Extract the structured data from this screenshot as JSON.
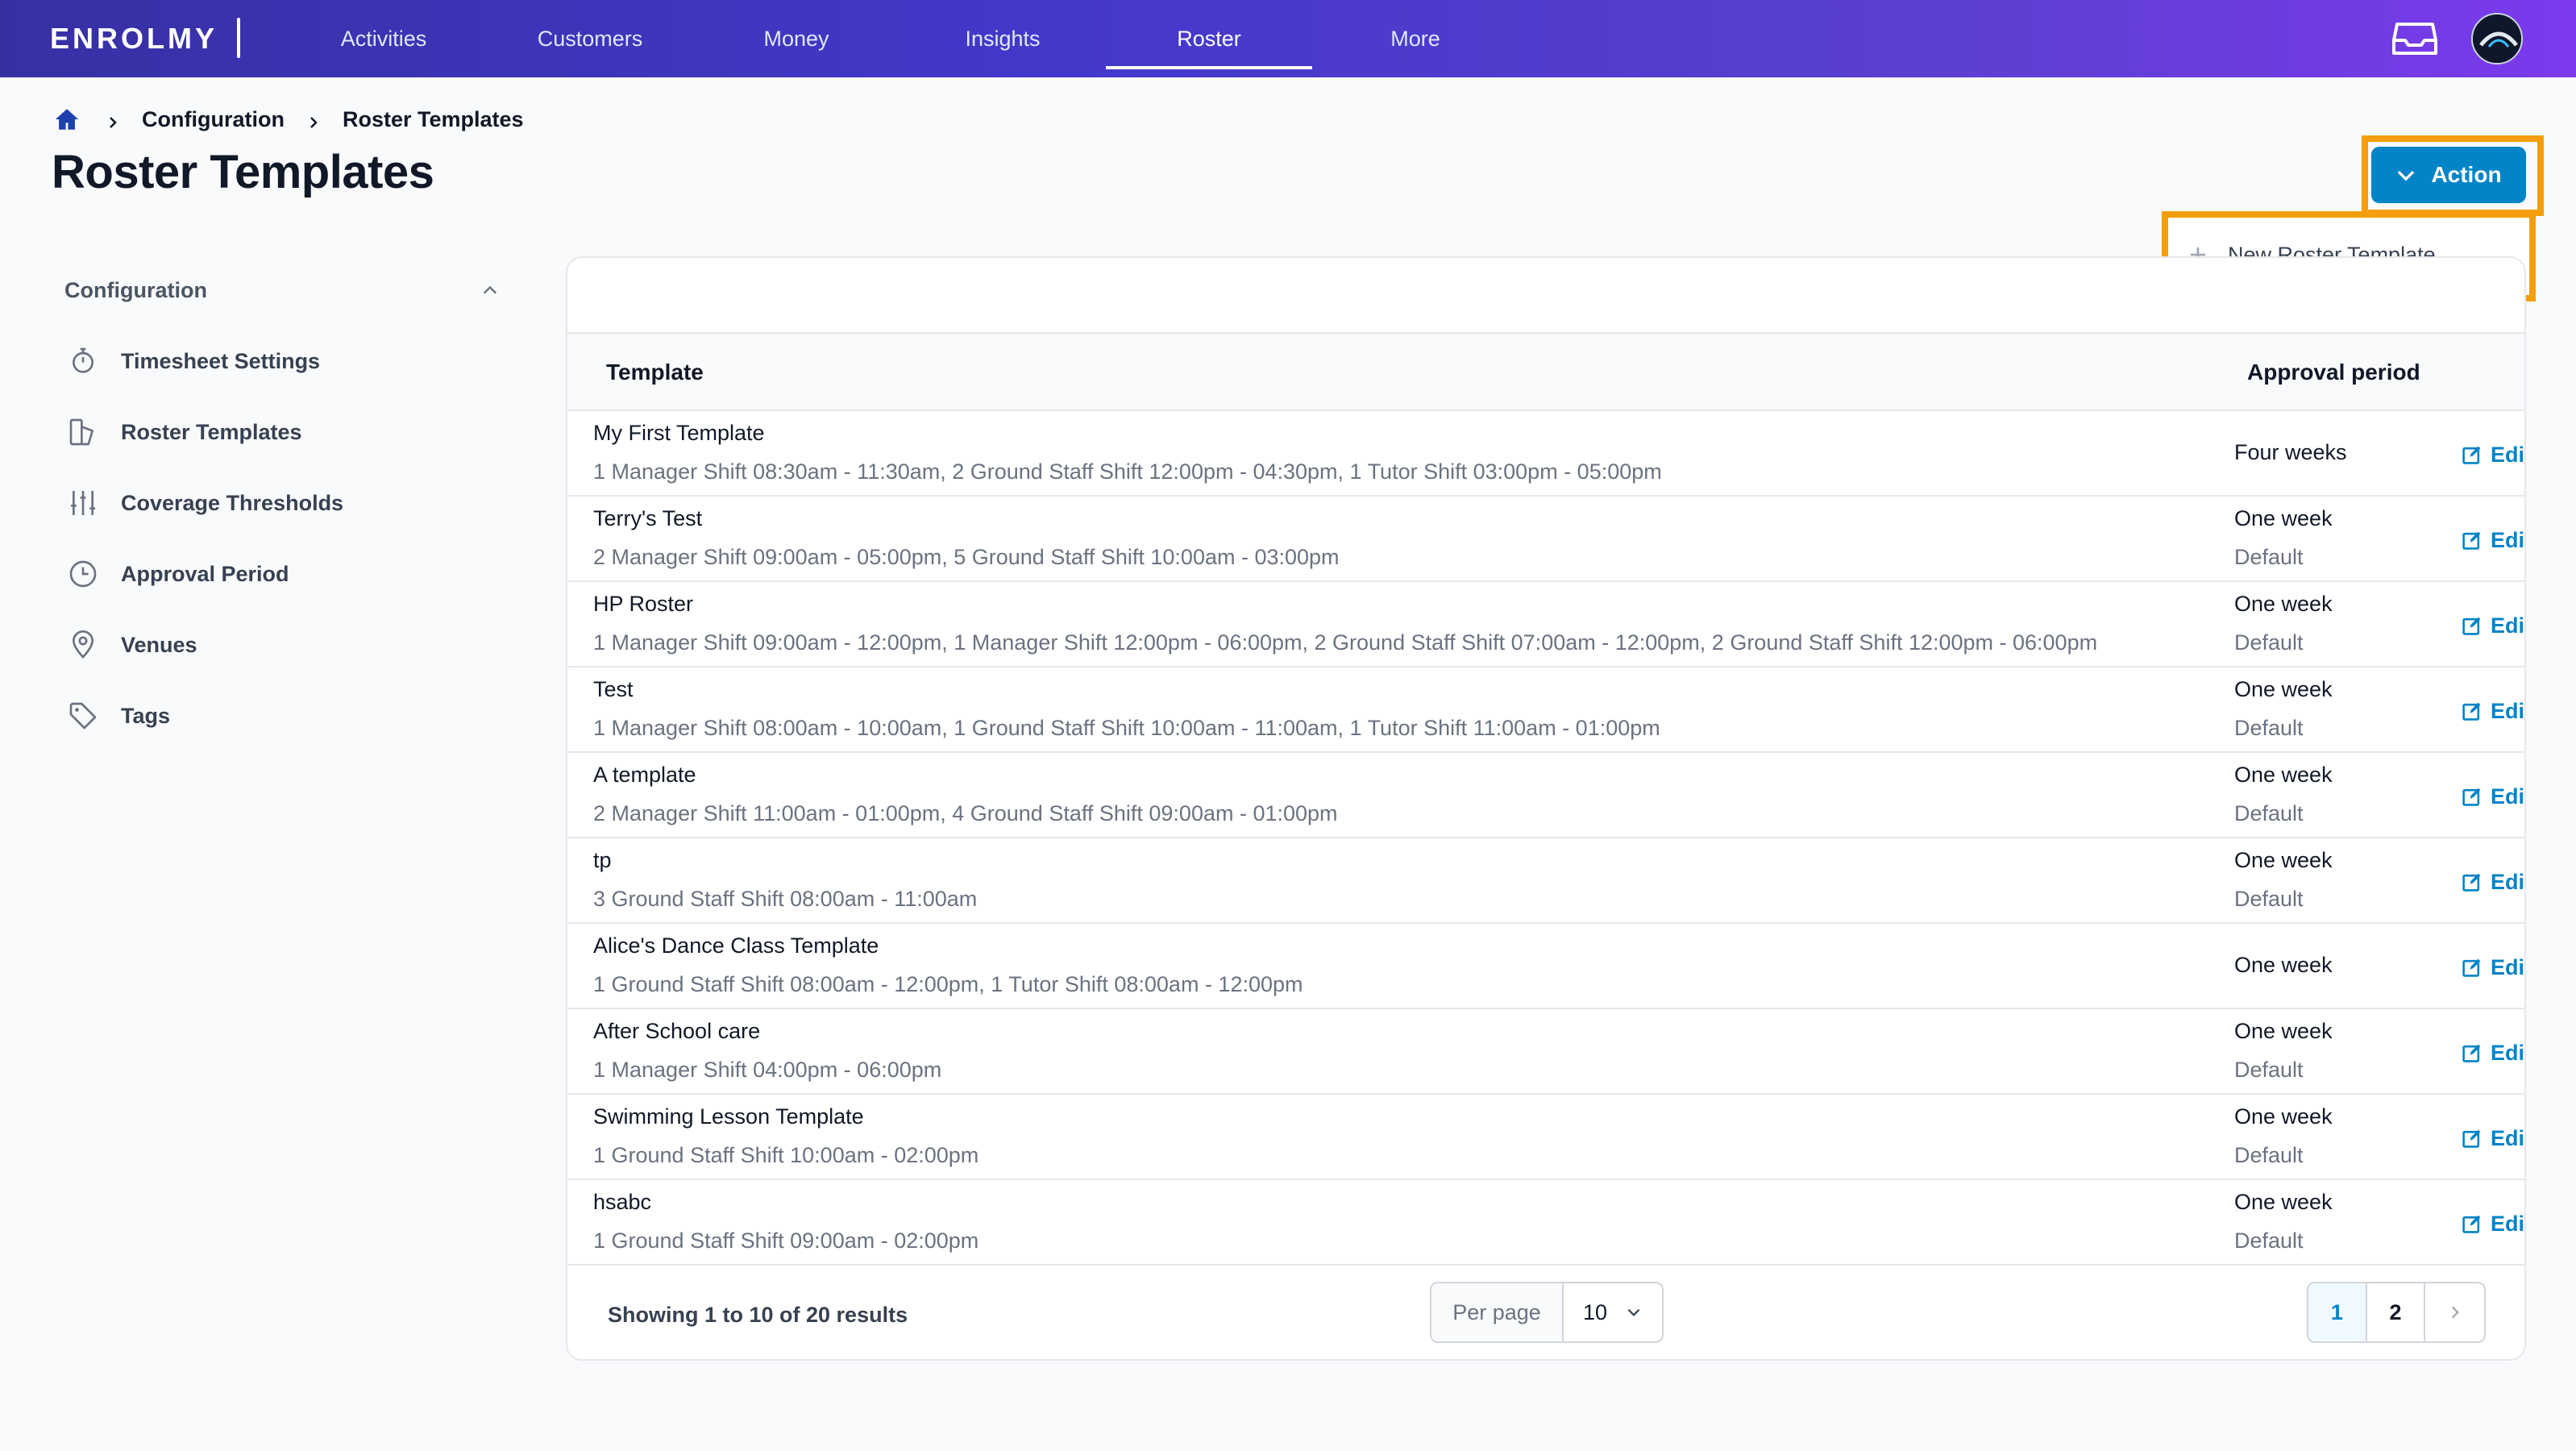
{
  "app": {
    "brand": "ENROLMY",
    "nav": [
      {
        "label": "Activities",
        "active": false
      },
      {
        "label": "Customers",
        "active": false
      },
      {
        "label": "Money",
        "active": false
      },
      {
        "label": "Insights",
        "active": false
      },
      {
        "label": "Roster",
        "active": true
      },
      {
        "label": "More",
        "active": false
      }
    ],
    "colors": {
      "nav_start": "#3730a3",
      "nav_end": "#7c3aed",
      "accent": "#0284c7",
      "highlight": "#f59e0b"
    }
  },
  "breadcrumb": {
    "items": [
      "Configuration",
      "Roster Templates"
    ]
  },
  "page": {
    "title": "Roster Templates"
  },
  "action": {
    "label": "Action",
    "menu": [
      {
        "label": "New Roster Template",
        "icon": "plus-icon"
      }
    ]
  },
  "sidebar": {
    "heading": "Configuration",
    "items": [
      {
        "label": "Timesheet Settings",
        "icon": "stopwatch-icon"
      },
      {
        "label": "Roster Templates",
        "icon": "template-icon"
      },
      {
        "label": "Coverage Thresholds",
        "icon": "sliders-icon"
      },
      {
        "label": "Approval Period",
        "icon": "clock-icon"
      },
      {
        "label": "Venues",
        "icon": "map-pin-icon"
      },
      {
        "label": "Tags",
        "icon": "tag-icon"
      }
    ]
  },
  "table": {
    "columns": [
      "Template",
      "Approval period"
    ],
    "edit_label": "Edi",
    "rows": [
      {
        "name": "My First Template",
        "shifts": "1 Manager Shift 08:30am - 11:30am, 2 Ground Staff Shift 12:00pm - 04:30pm, 1 Tutor Shift 03:00pm - 05:00pm",
        "approval": "Four weeks",
        "default": ""
      },
      {
        "name": "Terry's Test",
        "shifts": "2 Manager Shift 09:00am - 05:00pm, 5 Ground Staff Shift 10:00am - 03:00pm",
        "approval": "One week",
        "default": "Default"
      },
      {
        "name": "HP Roster",
        "shifts": "1 Manager Shift 09:00am - 12:00pm, 1 Manager Shift 12:00pm - 06:00pm, 2 Ground Staff Shift 07:00am - 12:00pm, 2 Ground Staff Shift 12:00pm - 06:00pm",
        "approval": "One week",
        "default": "Default"
      },
      {
        "name": "Test",
        "shifts": "1 Manager Shift 08:00am - 10:00am, 1 Ground Staff Shift 10:00am - 11:00am, 1 Tutor Shift 11:00am - 01:00pm",
        "approval": "One week",
        "default": "Default"
      },
      {
        "name": "A template",
        "shifts": "2 Manager Shift 11:00am - 01:00pm, 4 Ground Staff Shift 09:00am - 01:00pm",
        "approval": "One week",
        "default": "Default"
      },
      {
        "name": "tp",
        "shifts": "3 Ground Staff Shift 08:00am - 11:00am",
        "approval": "One week",
        "default": "Default"
      },
      {
        "name": "Alice's Dance Class Template",
        "shifts": "1 Ground Staff Shift 08:00am - 12:00pm, 1 Tutor Shift 08:00am - 12:00pm",
        "approval": "One week",
        "default": ""
      },
      {
        "name": "After School care",
        "shifts": "1 Manager Shift 04:00pm - 06:00pm",
        "approval": "One week",
        "default": "Default"
      },
      {
        "name": "Swimming Lesson Template",
        "shifts": "1 Ground Staff Shift 10:00am - 02:00pm",
        "approval": "One week",
        "default": "Default"
      },
      {
        "name": "hsabc",
        "shifts": "1 Ground Staff Shift 09:00am - 02:00pm",
        "approval": "One week",
        "default": "Default"
      }
    ]
  },
  "footer": {
    "showing": "Showing 1 to 10 of 20 results",
    "per_page_label": "Per page",
    "per_page_value": "10",
    "pages": [
      "1",
      "2"
    ],
    "current_page": "1"
  }
}
